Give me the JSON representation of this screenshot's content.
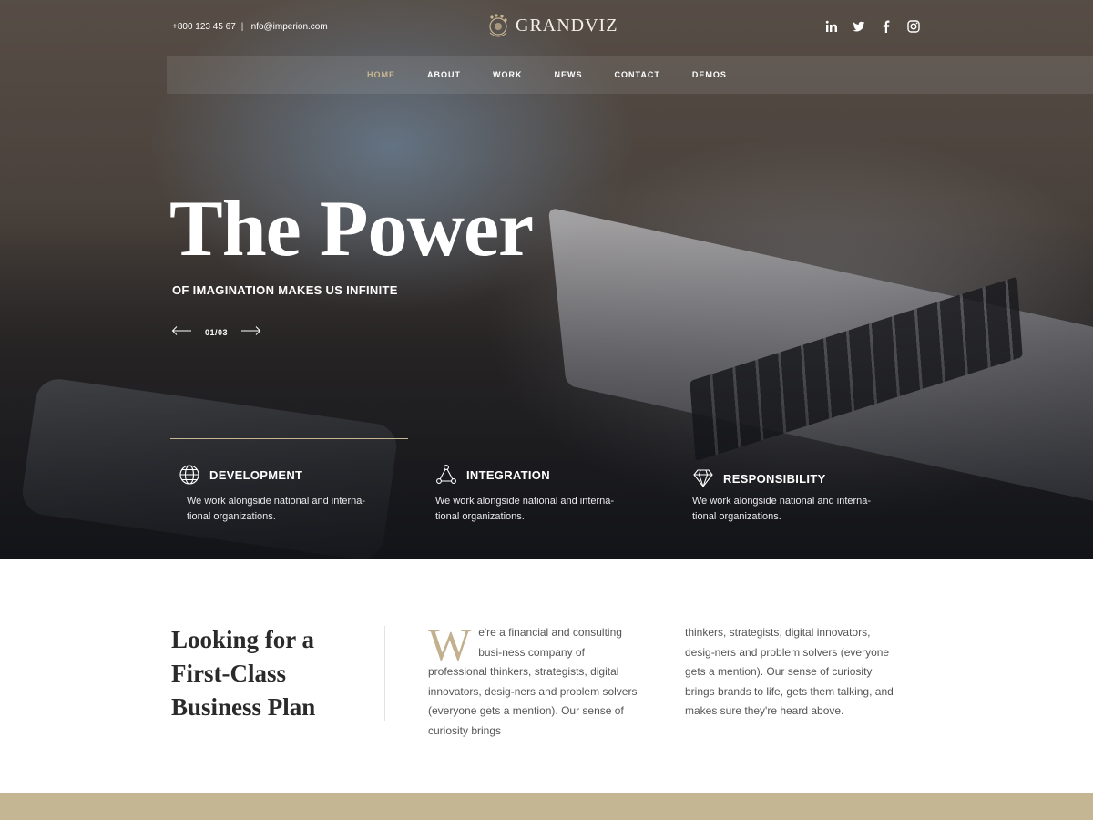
{
  "topbar": {
    "phone": "+800 123 45 67",
    "separator": "|",
    "email": "info@imperion.com",
    "brand": "GRANDVIZ",
    "socials": [
      "linkedin-icon",
      "twitter-icon",
      "facebook-icon",
      "instagram-icon"
    ]
  },
  "nav": {
    "items": [
      {
        "label": "HOME",
        "active": true
      },
      {
        "label": "ABOUT",
        "active": false
      },
      {
        "label": "WORK",
        "active": false
      },
      {
        "label": "NEWS",
        "active": false
      },
      {
        "label": "CONTACT",
        "active": false
      },
      {
        "label": "DEMOS",
        "active": false
      }
    ]
  },
  "hero": {
    "headline": "The Power",
    "subheadline": "OF IMAGINATION MAKES US INFINITE",
    "slide_counter": "01/03"
  },
  "features": [
    {
      "icon": "globe-icon",
      "title": "DEVELOPMENT",
      "text": "We work alongside national and interna-tional organizations."
    },
    {
      "icon": "network-icon",
      "title": "INTEGRATION",
      "text": "We work alongside national and interna-tional organizations."
    },
    {
      "icon": "diamond-icon",
      "title": "RESPONSIBILITY",
      "text": "We work alongside national and interna-tional organizations."
    }
  ],
  "about": {
    "title": "Looking for a First-Class Business Plan",
    "dropcap": "W",
    "col1_text": "e're a financial and consulting busi-ness company of professional thinkers, strategists, digital innovators, desig-ners and problem solvers (everyone gets a mention). Our sense of curiosity brings",
    "col2_text": "thinkers, strategists, digital innovators, desig-ners and problem solvers (everyone gets a mention). Our sense of curiosity brings brands to life, gets them talking, and makes sure they're heard above."
  },
  "colors": {
    "accent": "#c8b591",
    "band": "#c4b593",
    "dropcap": "#c2b08e"
  }
}
